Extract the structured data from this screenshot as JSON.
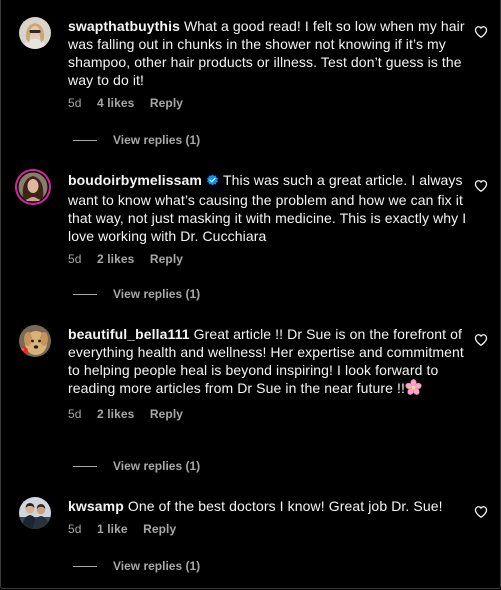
{
  "comments": [
    {
      "username": "swapthatbuythis",
      "text": "What a good read! I felt so low when my hair was falling out in chunks in the shower not knowing if it’s my shampoo, other hair products or illness. Test don’t guess is the way to do it!",
      "time": "5d",
      "likes": "4 likes",
      "reply": "Reply",
      "view_replies": "View replies (1)",
      "avatar_icon": "avatar-blonde-woman-icon"
    },
    {
      "username": "boudoirbymelissam",
      "verified": true,
      "text": "This was such a great article. I always want to know what’s causing the problem and how we can fix it that way, not just masking it with medicine. This is exactly why I love working with Dr. Cucchiara",
      "time": "5d",
      "likes": "2 likes",
      "reply": "Reply",
      "view_replies": "View replies (1)",
      "avatar_icon": "avatar-dark-haired-woman-icon"
    },
    {
      "username": "beautiful_bella111",
      "text": "Great article !! Dr Sue is on the forefront of everything health and wellness! Her expertise and commitment to helping people heal is beyond inspiring! I look forward to reading more articles from Dr Sue in the near future !!",
      "emoji": "🌸",
      "time": "5d",
      "likes": "2 likes",
      "reply": "Reply",
      "view_replies": "View replies (1)",
      "avatar_icon": "avatar-golden-dog-icon"
    },
    {
      "username": "kwsamp",
      "text": "One of the best doctors I know! Great job Dr. Sue!",
      "time": "5d",
      "likes": "1 like",
      "reply": "Reply",
      "view_replies": "View replies (1)",
      "avatar_icon": "avatar-two-people-icon"
    }
  ],
  "colors": {
    "background": "#000000",
    "text": "#f5f5f5",
    "secondary": "#a8a8a8",
    "verified": "#0095f6",
    "story_ring": "#d6249f"
  }
}
